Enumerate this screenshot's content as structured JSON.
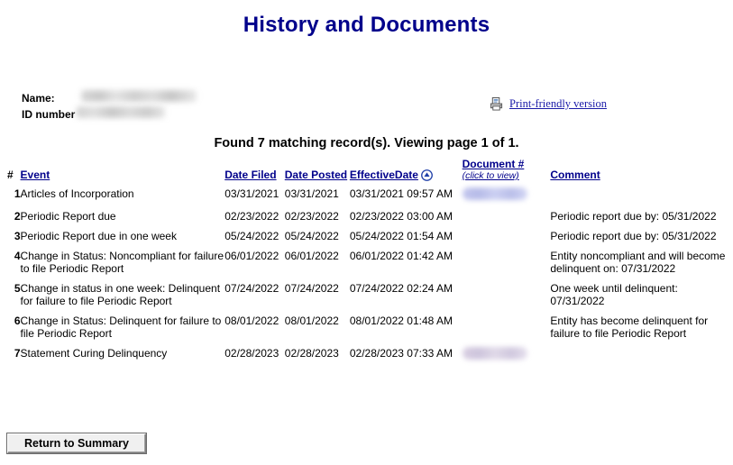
{
  "page": {
    "title": "History and Documents",
    "title_color": "#00008b",
    "found_line": "Found 7 matching record(s).  Viewing page 1 of 1."
  },
  "identity": {
    "name_label": "Name:",
    "name_value": "",
    "id_label": "ID number",
    "id_value": ""
  },
  "print": {
    "icon": "printer-icon",
    "label": "Print-friendly version"
  },
  "table": {
    "headers": {
      "number": "#",
      "event": "Event",
      "date_filed": "Date Filed",
      "date_posted": "Date Posted",
      "effective_date": "EffectiveDate",
      "sort_icon": "sort-ascending-icon",
      "document": "Document #",
      "document_sub": "(click to view)",
      "comment": "Comment"
    },
    "rows": [
      {
        "num": "1",
        "event": "Articles of Incorporation",
        "date_filed": "03/31/2021",
        "date_posted": "03/31/2021",
        "effective_date": "03/31/2021 09:57 AM",
        "document": "",
        "document_redacted": true,
        "comment": ""
      },
      {
        "num": "2",
        "event": "Periodic Report due",
        "date_filed": "02/23/2022",
        "date_posted": "02/23/2022",
        "effective_date": "02/23/2022 03:00 AM",
        "document": "",
        "document_redacted": false,
        "comment": "Periodic report due by: 05/31/2022"
      },
      {
        "num": "3",
        "event": "Periodic Report due in one week",
        "date_filed": "05/24/2022",
        "date_posted": "05/24/2022",
        "effective_date": "05/24/2022 01:54 AM",
        "document": "",
        "document_redacted": false,
        "comment": "Periodic report due by: 05/31/2022"
      },
      {
        "num": "4",
        "event": "Change in Status: Noncompliant for failure to file Periodic Report",
        "date_filed": "06/01/2022",
        "date_posted": "06/01/2022",
        "effective_date": "06/01/2022 01:42 AM",
        "document": "",
        "document_redacted": false,
        "comment": "Entity noncompliant and will become delinquent on: 07/31/2022"
      },
      {
        "num": "5",
        "event": "Change in status in one week: Delinquent for failure to file Periodic Report",
        "date_filed": "07/24/2022",
        "date_posted": "07/24/2022",
        "effective_date": "07/24/2022 02:24 AM",
        "document": "",
        "document_redacted": false,
        "comment": "One week until delinquent: 07/31/2022"
      },
      {
        "num": "6",
        "event": "Change in Status: Delinquent for failure to file Periodic Report",
        "date_filed": "08/01/2022",
        "date_posted": "08/01/2022",
        "effective_date": "08/01/2022 01:48 AM",
        "document": "",
        "document_redacted": false,
        "comment": "Entity has become delinquent for failure to file Periodic Report"
      },
      {
        "num": "7",
        "event": "Statement Curing Delinquency",
        "date_filed": "02/28/2023",
        "date_posted": "02/28/2023",
        "effective_date": "02/28/2023 07:33 AM",
        "document": "",
        "document_redacted": true,
        "comment": ""
      }
    ]
  },
  "footer": {
    "return_button": "Return to Summary"
  }
}
